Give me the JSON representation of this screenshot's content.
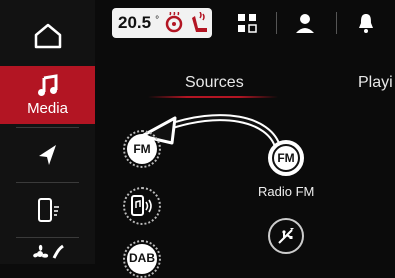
{
  "rail": {
    "items": [
      {
        "name": "home",
        "icon": "home-icon"
      },
      {
        "name": "media",
        "icon": "music-note-icon",
        "label": "Media",
        "active": true
      },
      {
        "name": "navigation",
        "icon": "navigation-arrow-icon"
      },
      {
        "name": "phone",
        "icon": "phone-icon"
      },
      {
        "name": "climate",
        "icon": "fan-icon"
      }
    ],
    "active_color": "#b31523"
  },
  "statusbar": {
    "temperature": "20.5",
    "temperature_unit": "°",
    "icons": [
      "steering-wheel-heat-icon",
      "seat-heat-icon",
      "apps-grid-icon",
      "user-icon",
      "bell-icon"
    ]
  },
  "tabs": {
    "sources_label": "Sources",
    "playing_label": "Playi"
  },
  "sources": {
    "fm_label": "FM",
    "dab_label": "DAB",
    "radio_fm_label": "Radio FM",
    "icons": [
      "fm-icon",
      "phone-bluetooth-icon",
      "dab-icon",
      "usb-icon"
    ]
  }
}
